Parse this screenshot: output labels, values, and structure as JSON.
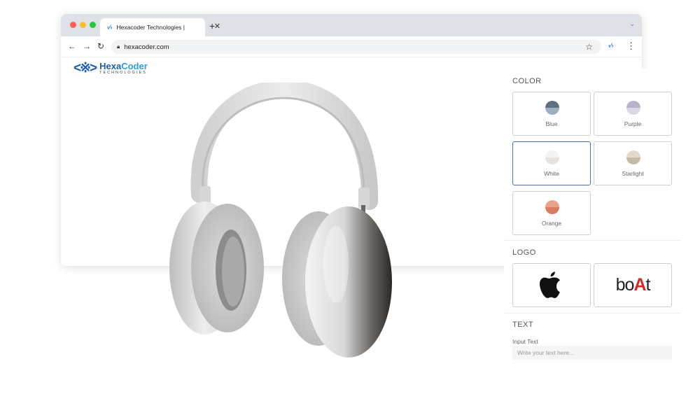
{
  "browser": {
    "tab_title": "Hexacoder Technologies |",
    "tab_close": "✕",
    "new_tab": "+",
    "url": "hexacoder.com",
    "traffic_colors": [
      "#ff5f57",
      "#febc2e",
      "#28c840"
    ]
  },
  "brand": {
    "name_part1": "Hexa",
    "name_part2": "Coder",
    "subtitle": "TECHNOLOGIES"
  },
  "panel": {
    "color_title": "COLOR",
    "colors": [
      {
        "label": "Blue",
        "top": "#5f7180",
        "bottom": "#9db0bf",
        "selected": false
      },
      {
        "label": "Purple",
        "top": "#b9b1c9",
        "bottom": "#dcd7e6",
        "selected": false
      },
      {
        "label": "White",
        "top": "#f3f3f3",
        "bottom": "#e7e3de",
        "selected": true
      },
      {
        "label": "Starlight",
        "top": "#e4d9cc",
        "bottom": "#c6b9a8",
        "selected": false
      },
      {
        "label": "Orange",
        "top": "#e8a288",
        "bottom": "#d97b5e",
        "selected": false
      }
    ],
    "logo_title": "LOGO",
    "logos": [
      "apple",
      "boAt"
    ],
    "text_title": "TEXT",
    "input_label": "Input Text",
    "input_placeholder": "Write your text here..."
  }
}
